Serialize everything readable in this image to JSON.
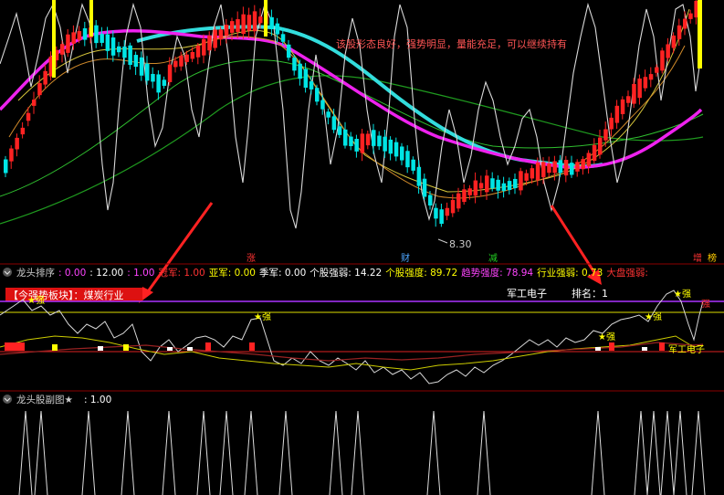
{
  "main_chart": {
    "annotation": "该股形态良好，强势明显，量能充足，可以继续持有",
    "low_price_label": "8.30",
    "tags": [
      {
        "text": "涨",
        "color": "#ff3333"
      },
      {
        "text": "财",
        "color": "#4da6ff"
      },
      {
        "text": "减",
        "color": "#22cc22"
      },
      {
        "text": "增",
        "color": "#ff3333"
      },
      {
        "text": "榜",
        "color": "#ffcc00"
      }
    ]
  },
  "indicator_panel": {
    "header": [
      {
        "text": "龙头排序",
        "color": "#cccccc"
      },
      {
        "text": ": 0.00",
        "color": "#ff44ff"
      },
      {
        "text": ": 12.00",
        "color": "#ffffff"
      },
      {
        "text": ": 1.00",
        "color": "#ff44ff"
      },
      {
        "text": "冠军: 1.00",
        "color": "#ff3333"
      },
      {
        "text": "亚军: 0.00",
        "color": "#ffff00"
      },
      {
        "text": "季军: 0.00",
        "color": "#ffffff"
      },
      {
        "text": "个股强弱: 14.22",
        "color": "#ffffff"
      },
      {
        "text": "个股强度: 89.72",
        "color": "#ffff00"
      },
      {
        "text": "趋势强度: 78.94",
        "color": "#ff44ff"
      },
      {
        "text": "行业强弱: 0.73",
        "color": "#ffff00"
      },
      {
        "text": "大盘强弱:",
        "color": "#ff3333"
      }
    ],
    "sector_badge": "【今强势板块】：煤炭行业",
    "industry": "军工电子",
    "rank_label": "排名：1",
    "strong_labels": [
      "★强",
      "★强",
      "★强",
      "★强",
      "★强"
    ],
    "side_label": "强",
    "industry_label_right": "军工电子"
  },
  "sub_panel": {
    "title": "龙头股副图★",
    "value": ": 1.00"
  },
  "colors": {
    "background": "#000000",
    "up_candle": "#ff2222",
    "down_candle": "#00e5e5",
    "ma_cyan": "#33dddd",
    "ma_magenta": "#ee22ee",
    "ma_green": "#22aa22",
    "ma_yellow": "#ffff00",
    "line_white": "#dddddd",
    "divider": "#8b0000"
  }
}
